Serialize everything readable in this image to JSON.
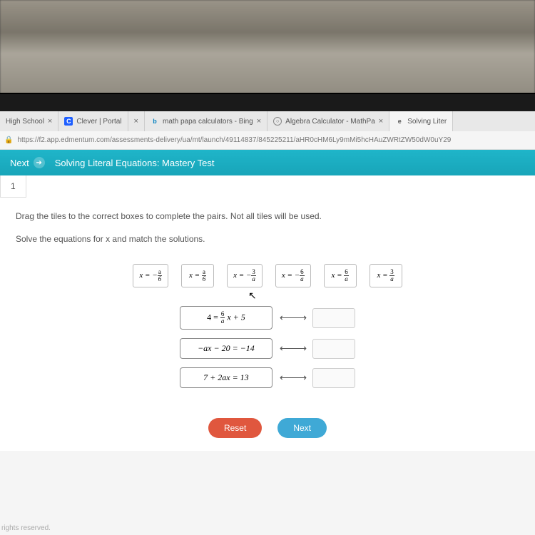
{
  "tabs": [
    {
      "label": "High School",
      "favicon": ""
    },
    {
      "label": "Clever | Portal",
      "favicon": "C"
    },
    {
      "label": "",
      "favicon": ""
    },
    {
      "label": "math papa calculators - Bing",
      "favicon": "b"
    },
    {
      "label": "Algebra Calculator - MathPa",
      "favicon": "○"
    },
    {
      "label": "Solving Liter",
      "favicon": "e"
    }
  ],
  "url": "https://f2.app.edmentum.com/assessments-delivery/ua/mt/launch/49114837/845225211/aHR0cHM6Ly9mMi5hcHAuZWRtZW50dW0uY29",
  "header": {
    "next": "Next",
    "title": "Solving Literal Equations: Mastery Test"
  },
  "page_number": "1",
  "instruction_line1": "Drag the tiles to the correct boxes to complete the pairs. Not all tiles will be used.",
  "instruction_line2": "Solve the equations for x and match the solutions.",
  "tiles": [
    {
      "prefix": "x = −",
      "num": "a",
      "den": "6"
    },
    {
      "prefix": "x = ",
      "num": "a",
      "den": "6"
    },
    {
      "prefix": "x = −",
      "num": "3",
      "den": "a"
    },
    {
      "prefix": "x = −",
      "num": "6",
      "den": "a"
    },
    {
      "prefix": "x = ",
      "num": "6",
      "den": "a"
    },
    {
      "prefix": "x = ",
      "num": "3",
      "den": "a"
    }
  ],
  "equations": {
    "eq1_left": "4 = ",
    "eq1_num": "6",
    "eq1_den": "a",
    "eq1_right": "x + 5",
    "eq2": "−ax − 20 = −14",
    "eq3": "7 + 2ax = 13"
  },
  "buttons": {
    "reset": "Reset",
    "next": "Next"
  },
  "footer": "rights reserved."
}
